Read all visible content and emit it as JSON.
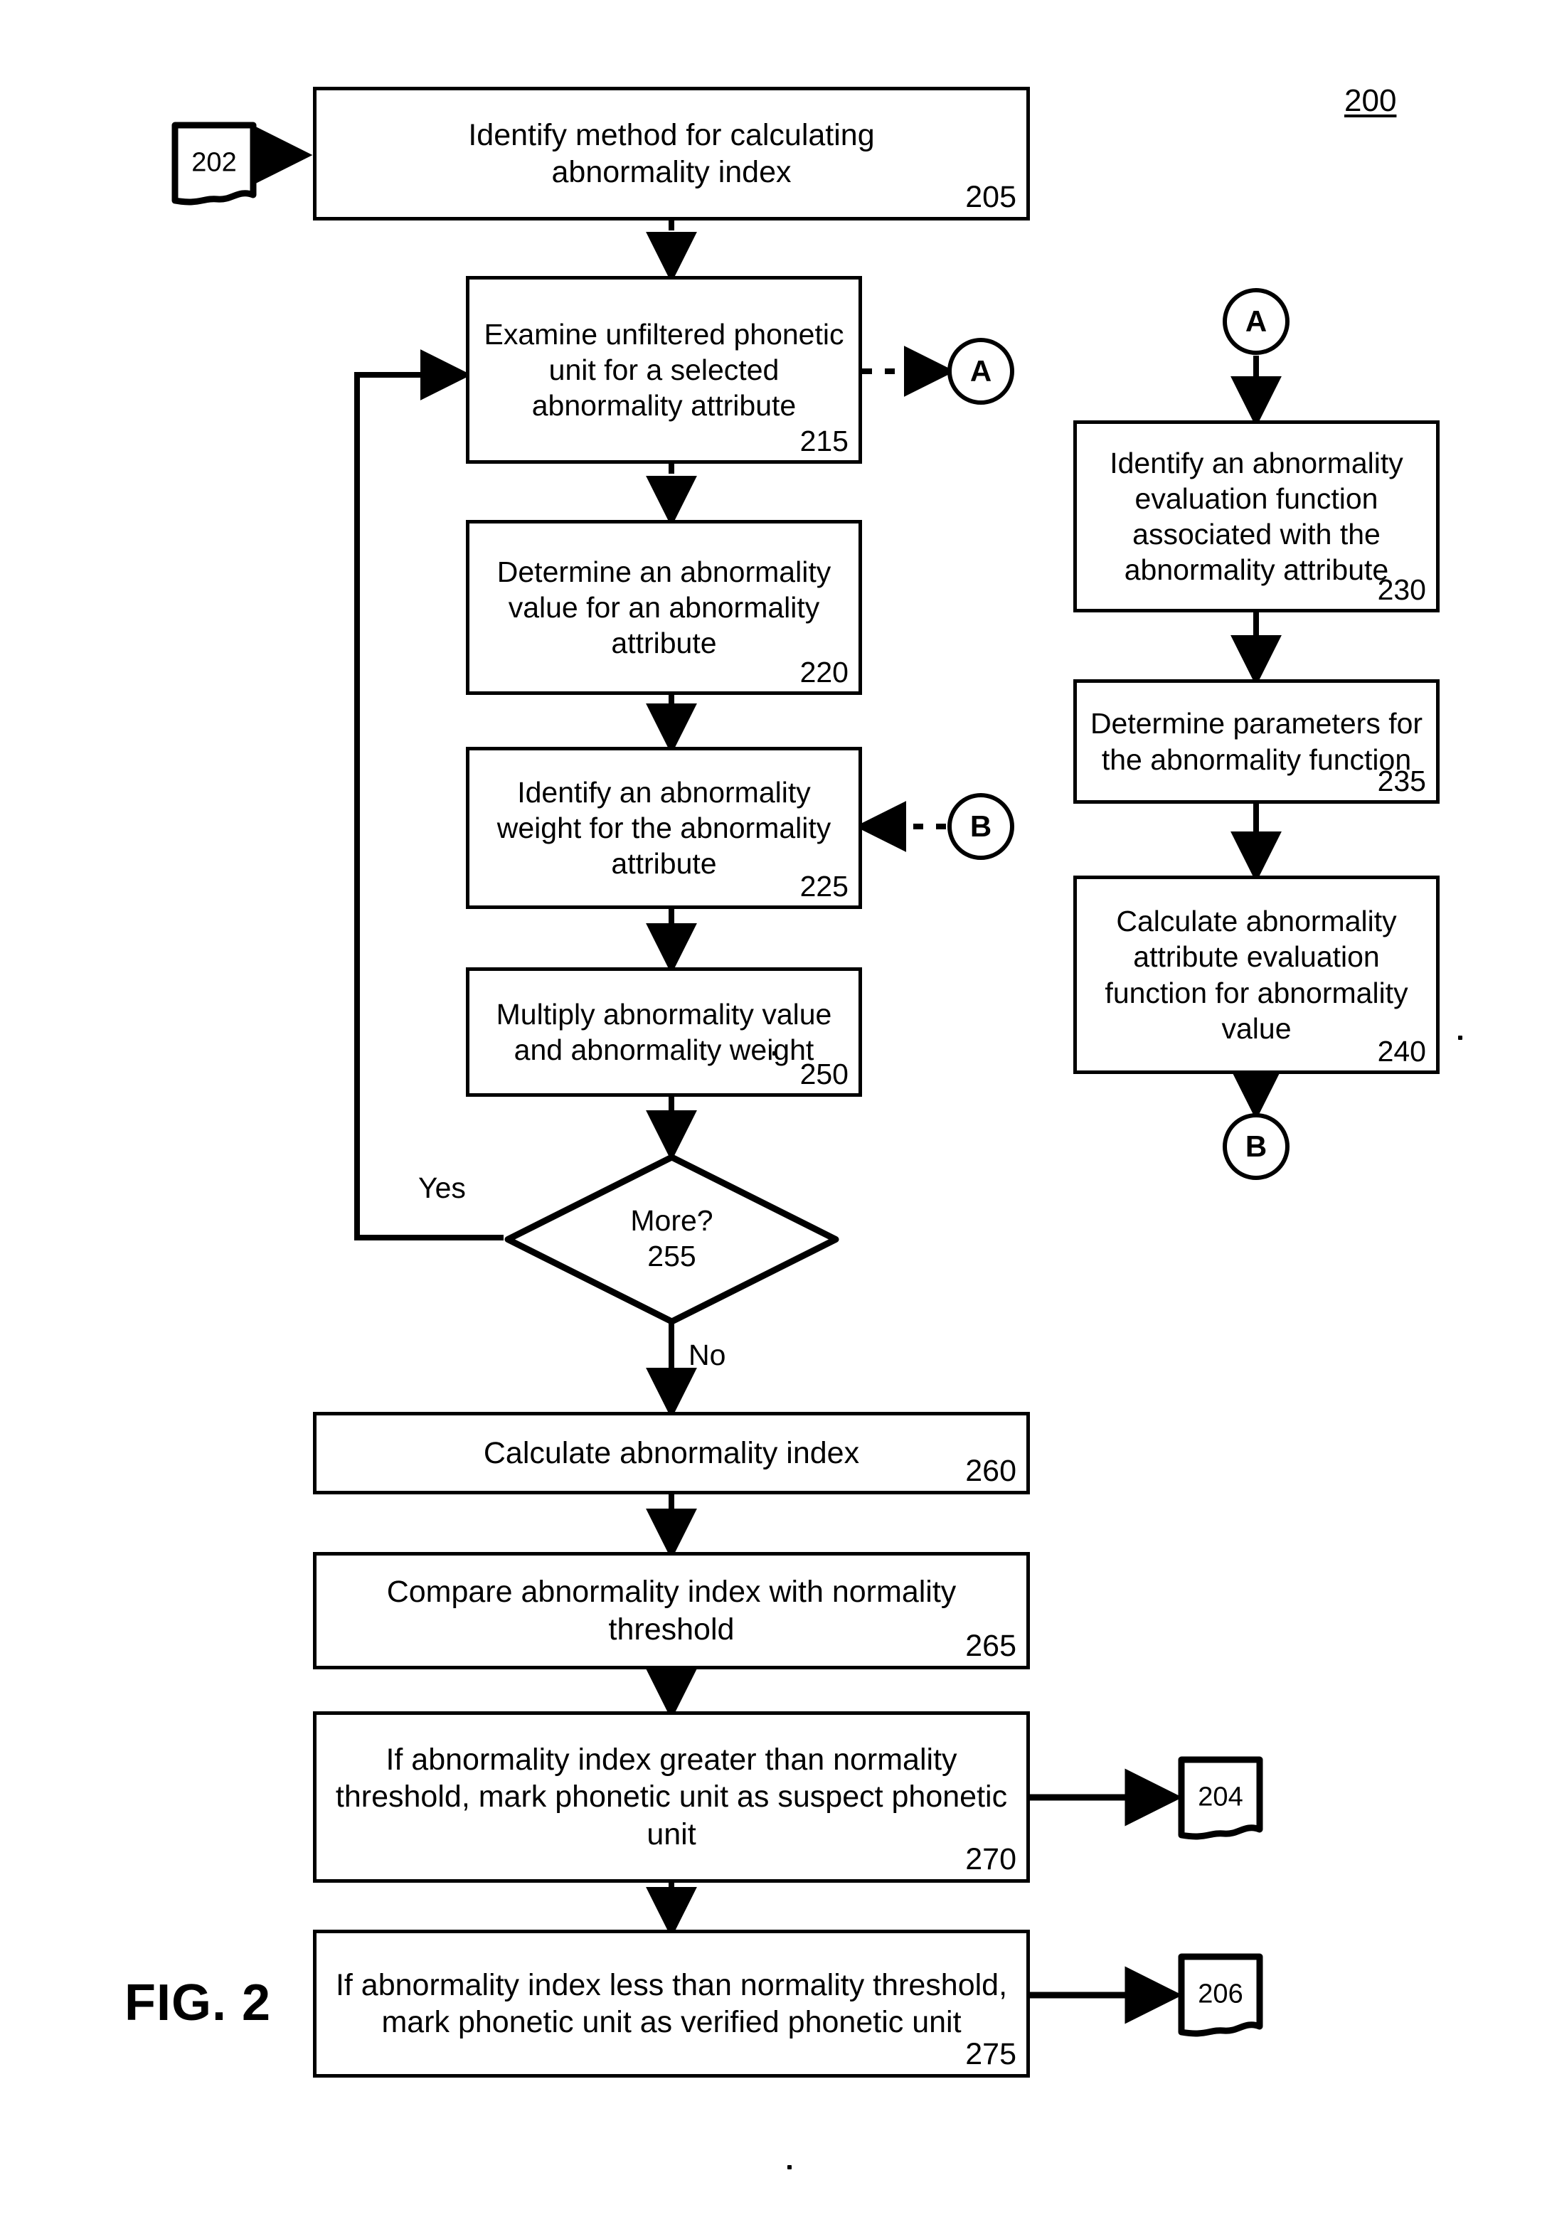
{
  "figure": {
    "label": "FIG. 2",
    "number": "200"
  },
  "terminals": [
    {
      "id": "t202",
      "number": "202"
    },
    {
      "id": "t204",
      "number": "204"
    },
    {
      "id": "t206",
      "number": "206"
    }
  ],
  "connectors": [
    {
      "id": "a_out",
      "letter": "A"
    },
    {
      "id": "a_in",
      "letter": "A"
    },
    {
      "id": "b_in",
      "letter": "B"
    },
    {
      "id": "b_out",
      "letter": "B"
    }
  ],
  "boxes": [
    {
      "id": "box205",
      "text": "Identify method for calculating\nabnormality index",
      "number": "205"
    },
    {
      "id": "box215",
      "text": "Examine unfiltered phonetic\nunit for a selected\nabnormality attribute",
      "number": "215"
    },
    {
      "id": "box220",
      "text": "Determine an abnormality\nvalue for an abnormality\nattribute",
      "number": "220"
    },
    {
      "id": "box225",
      "text": "Identify an abnormality\nweight for the abnormality\nattribute",
      "number": "225"
    },
    {
      "id": "box250",
      "text": "Multiply abnormality value\nand abnormality weight",
      "number": "250"
    },
    {
      "id": "box260",
      "text": "Calculate abnormality index",
      "number": "260"
    },
    {
      "id": "box265",
      "text": "Compare abnormality index with normality\nthreshold",
      "number": "265"
    },
    {
      "id": "box270",
      "text": "If abnormality index greater than normality\nthreshold, mark phonetic unit as suspect phonetic\nunit",
      "number": "270"
    },
    {
      "id": "box275",
      "text": "If abnormality index less than normality threshold,\nmark phonetic unit as verified phonetic unit",
      "number": "275"
    },
    {
      "id": "box230",
      "text": "Identify an abnormality\nevaluation function\nassociated with the\nabnormality attribute",
      "number": "230"
    },
    {
      "id": "box235",
      "text": "Determine parameters for\nthe abnormality function",
      "number": "235"
    },
    {
      "id": "box240",
      "text": "Calculate abnormality\nattribute evaluation\nfunction for abnormality\nvalue",
      "number": "240"
    }
  ],
  "decision": {
    "id": "d255",
    "text": "More?\n255",
    "question": "More?",
    "number": "255",
    "yes_label": "Yes",
    "no_label": "No"
  },
  "colors": {
    "stroke": "#000000",
    "background": "#ffffff"
  }
}
